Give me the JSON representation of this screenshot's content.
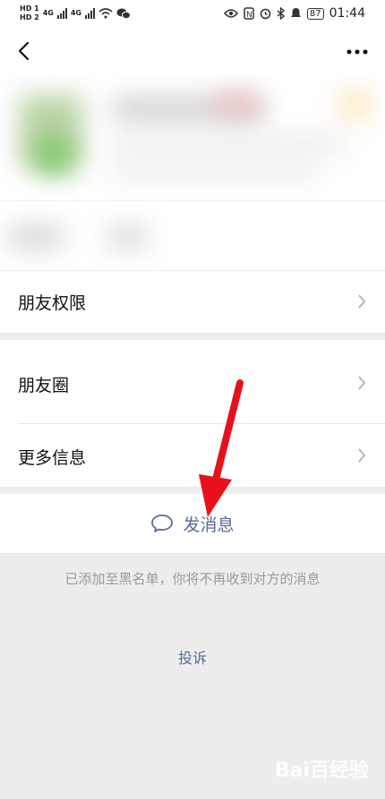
{
  "status_bar": {
    "sim_labels": [
      "HD 1",
      "HD 2"
    ],
    "network": [
      "4G",
      "4G"
    ],
    "battery": "87",
    "time": "01:44"
  },
  "rows": {
    "friend_permissions": "朋友权限",
    "moments": "朋友圈",
    "more_info": "更多信息"
  },
  "send_message": "发消息",
  "blocked_notice": "已添加至黑名单，你将不再收到对方的消息",
  "complain": "投诉",
  "watermark": "Bai百经验",
  "colors": {
    "link": "#576b95",
    "arrow": "#e8101a"
  }
}
